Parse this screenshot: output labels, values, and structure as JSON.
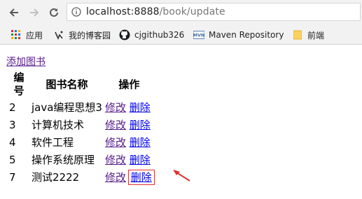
{
  "browser": {
    "url_host": "localhost:8888",
    "url_path": "/book/update"
  },
  "bookmarks": [
    {
      "label": "应用",
      "icon": "apps-grid-icon"
    },
    {
      "label": "我的博客园",
      "icon": "cnblogs-icon"
    },
    {
      "label": "cjgithub326",
      "icon": "github-icon"
    },
    {
      "label": "Maven Repository",
      "icon": "mvn-icon"
    },
    {
      "label": "前端",
      "icon": "folder-icon"
    }
  ],
  "page": {
    "add_link": "添加图书",
    "table_headers": [
      "编号",
      "图书名称",
      "操作"
    ],
    "edit_label": "修改",
    "delete_label": "删除",
    "rows": [
      {
        "id": "2",
        "name": "java编程思想3"
      },
      {
        "id": "3",
        "name": "计算机技术"
      },
      {
        "id": "4",
        "name": "软件工程"
      },
      {
        "id": "5",
        "name": "操作系统原理"
      },
      {
        "id": "7",
        "name": "测试2222"
      }
    ]
  },
  "colors": {
    "link": "#0000ee",
    "visited_link": "#551a8b",
    "annotation": "#e03030"
  }
}
